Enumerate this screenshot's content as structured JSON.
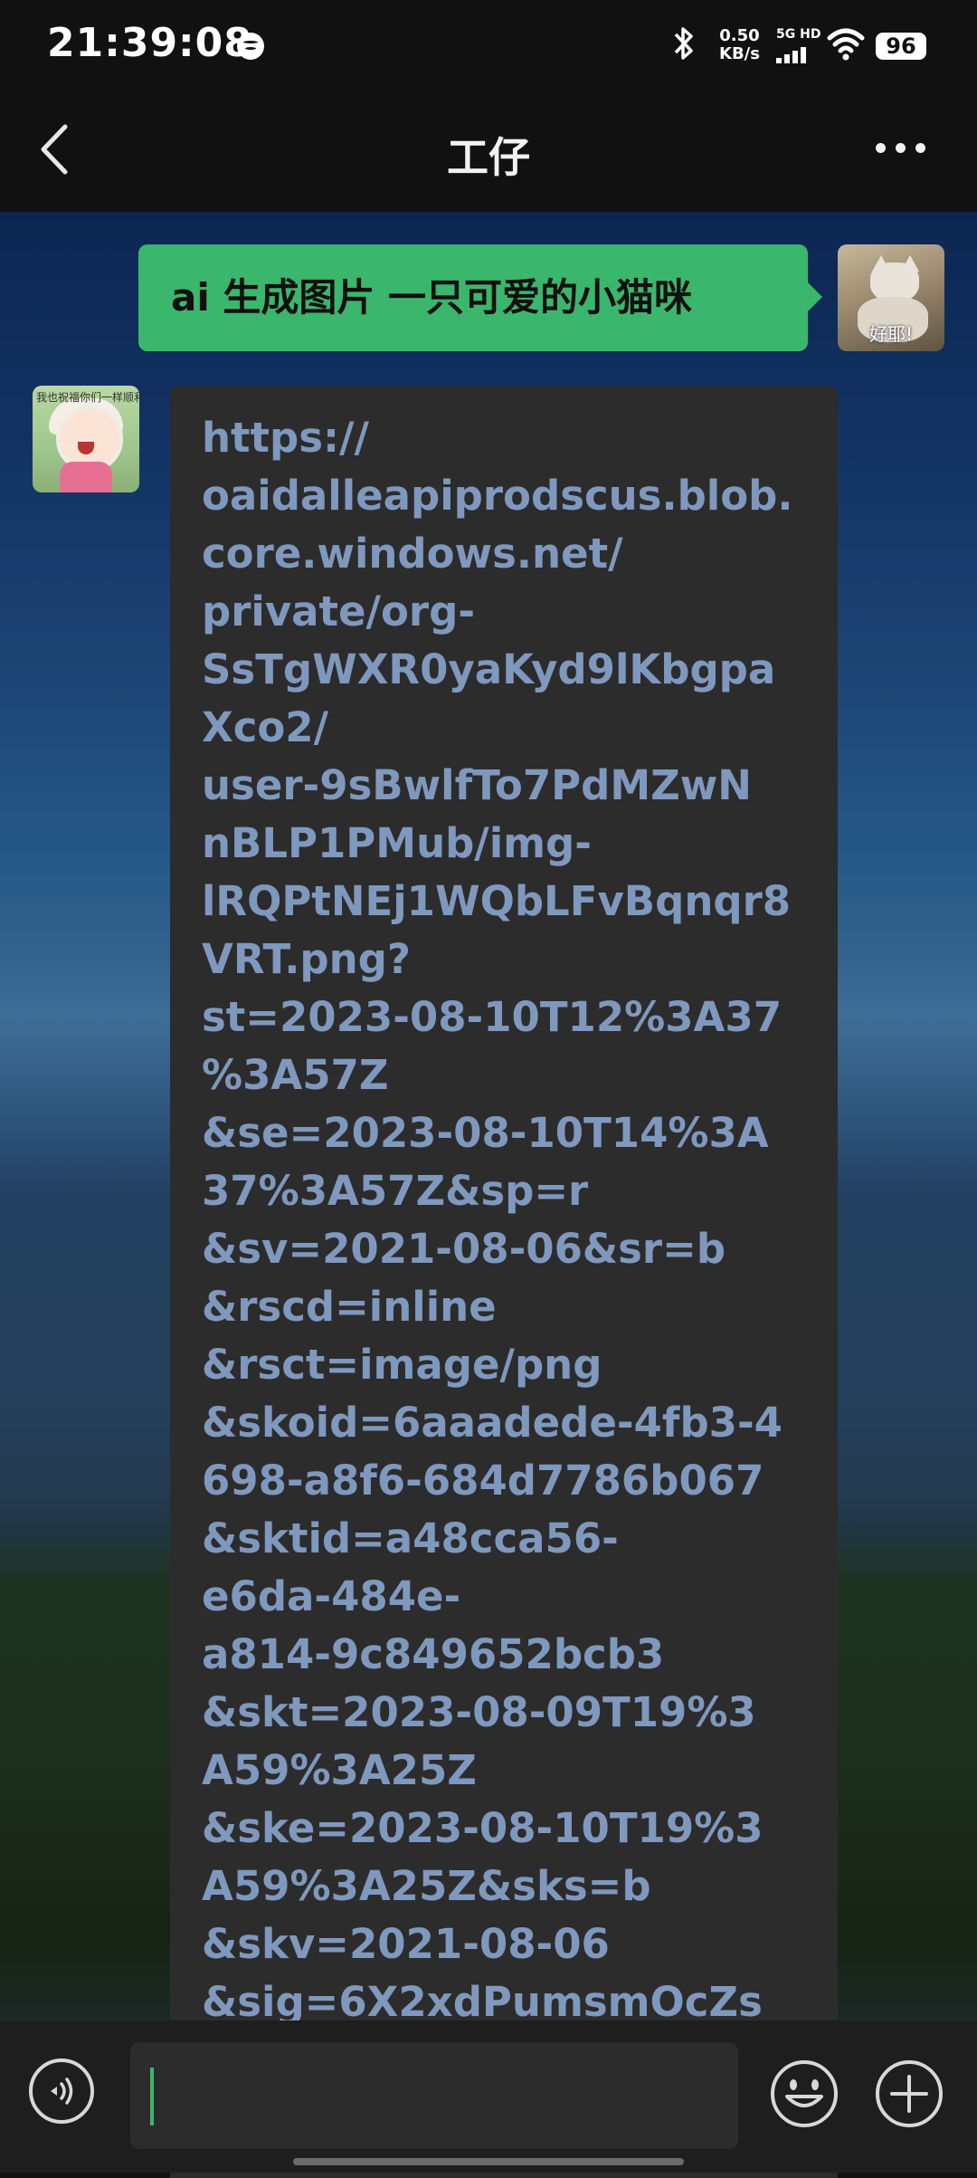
{
  "status_bar": {
    "time": "21:39:08",
    "speed_value": "0.50",
    "speed_unit": "KB/s",
    "network": "5G HD",
    "battery": "96",
    "icons": [
      "spotify-icon",
      "bluetooth-icon",
      "signal-icon",
      "wifi-icon",
      "battery-icon"
    ]
  },
  "header": {
    "title": "工仔",
    "back_icon": "chevron-left-icon",
    "more_icon": "more-dots-icon"
  },
  "messages": [
    {
      "sender": "me",
      "avatar_caption": "好耶!",
      "text": "ai 生成图片 一只可爱的小猫咪"
    },
    {
      "sender": "bot",
      "avatar_caption": "我也祝福你们一样顺利",
      "lines": [
        "https://",
        "oaidalleapiprodscus.blob.",
        "core.windows.net/",
        "private/org-",
        "SsTgWXR0yaKyd9lKbgpa",
        "Xco2/",
        "user-9sBwlfTo7PdMZwN",
        "nBLP1PMub/img-",
        "lRQPtNEj1WQbLFvBqnqr8",
        "VRT.png?",
        "st=2023-08-10T12%3A37",
        "%3A57Z",
        "&se=2023-08-10T14%3A",
        "37%3A57Z&sp=r",
        "&sv=2021-08-06&sr=b",
        "&rscd=inline",
        "&rsct=image/png",
        "&skoid=6aaadede-4fb3-4",
        "698-a8f6-684d7786b067",
        "&sktid=a48cca56-",
        "e6da-484e-",
        "a814-9c849652bcb3",
        "&skt=2023-08-09T19%3",
        "A59%3A25Z",
        "&ske=2023-08-10T19%3",
        "A59%3A25Z&sks=b",
        "&skv=2021-08-06",
        "&sig=6X2xdPumsmOcZs"
      ]
    }
  ],
  "input_bar": {
    "text_value": "",
    "icons": [
      "voice-icon",
      "emoji-icon",
      "plus-icon"
    ]
  },
  "colors": {
    "my_bubble": "#3bb66d",
    "bot_bubble": "#2c2c2c",
    "bot_text": "#7f98be",
    "bars": "#111111"
  }
}
